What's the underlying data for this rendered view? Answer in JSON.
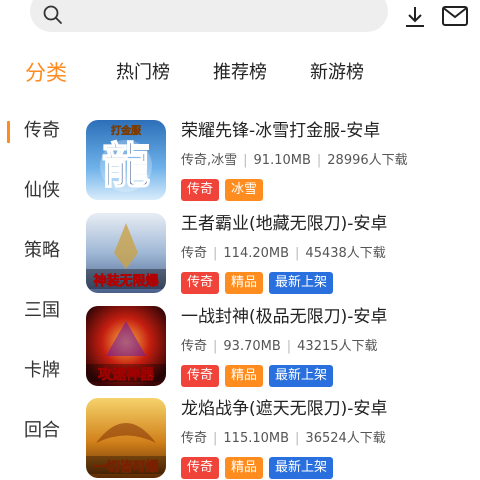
{
  "search": {
    "placeholder": ""
  },
  "tabs": [
    {
      "label": "分类",
      "active": true
    },
    {
      "label": "热门榜",
      "active": false
    },
    {
      "label": "推荐榜",
      "active": false
    },
    {
      "label": "新游榜",
      "active": false
    }
  ],
  "sidebar": {
    "items": [
      {
        "label": "传奇",
        "active": true
      },
      {
        "label": "仙侠"
      },
      {
        "label": "策略"
      },
      {
        "label": "三国"
      },
      {
        "label": "卡牌"
      },
      {
        "label": "回合"
      }
    ]
  },
  "games": [
    {
      "title": "荣耀先锋-冰雪打金服-安卓",
      "genre": "传奇,冰雪",
      "size": "91.10MB",
      "downloads": "28996人下载",
      "tags": [
        {
          "label": "传奇",
          "color": "#f0443a"
        },
        {
          "label": "冰雪",
          "color": "#ff8c1e"
        }
      ],
      "thumb_text": "龍",
      "thumb_subtext": "打金服"
    },
    {
      "title": "王者霸业(地藏无限刀)-安卓",
      "genre": "传奇",
      "size": "114.20MB",
      "downloads": "45438人下载",
      "tags": [
        {
          "label": "传奇",
          "color": "#f0443a"
        },
        {
          "label": "精品",
          "color": "#ff8c1e"
        },
        {
          "label": "最新上架",
          "color": "#2a6fde"
        }
      ],
      "thumb_text": "神装无限爆"
    },
    {
      "title": "一战封神(极品无限刀)-安卓",
      "genre": "传奇",
      "size": "93.70MB",
      "downloads": "43215人下载",
      "tags": [
        {
          "label": "传奇",
          "color": "#f0443a"
        },
        {
          "label": "精品",
          "color": "#ff8c1e"
        },
        {
          "label": "最新上架",
          "color": "#2a6fde"
        }
      ],
      "thumb_text": "攻速神器"
    },
    {
      "title": "龙焰战争(遮天无限刀)-安卓",
      "genre": "传奇",
      "size": "115.10MB",
      "downloads": "36524人下载",
      "tags": [
        {
          "label": "传奇",
          "color": "#f0443a"
        },
        {
          "label": "精品",
          "color": "#ff8c1e"
        },
        {
          "label": "最新上架",
          "color": "#2a6fde"
        }
      ],
      "thumb_text": "一切皆可爆"
    }
  ],
  "colors": {
    "accent": "#ff8a1e"
  }
}
